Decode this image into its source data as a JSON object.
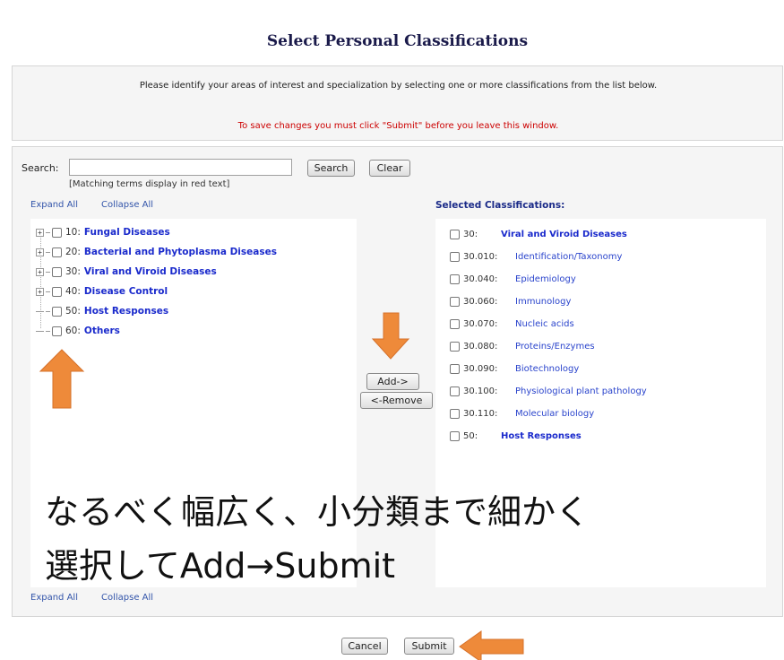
{
  "title": "Select Personal Classifications",
  "info": {
    "instruction": "Please identify your areas of interest and specialization by selecting one or more classifications from the list below.",
    "warning": "To save changes you must click \"Submit\" before you leave this window."
  },
  "search": {
    "label": "Search:",
    "value": "",
    "button_label": "Search",
    "clear_label": "Clear",
    "note": "[Matching terms display in red text]"
  },
  "links": {
    "expand_all": "Expand All",
    "collapse_all": "Collapse All"
  },
  "tree": {
    "items": [
      {
        "code": "10:",
        "label": "Fungal Diseases",
        "expandable": true
      },
      {
        "code": "20:",
        "label": "Bacterial and Phytoplasma Diseases",
        "expandable": true
      },
      {
        "code": "30:",
        "label": "Viral and Viroid Diseases",
        "expandable": true
      },
      {
        "code": "40:",
        "label": "Disease Control",
        "expandable": true
      },
      {
        "code": "50:",
        "label": "Host Responses",
        "expandable": false
      },
      {
        "code": "60:",
        "label": "Others",
        "expandable": false
      }
    ]
  },
  "actions": {
    "add_label": "Add->",
    "remove_label": "<-Remove"
  },
  "selected": {
    "heading": "Selected Classifications:",
    "items": [
      {
        "code": "30:",
        "label": "Viral and Viroid Diseases",
        "bold": true
      },
      {
        "code": "30.010:",
        "label": "Identification/Taxonomy",
        "bold": false
      },
      {
        "code": "30.040:",
        "label": "Epidemiology",
        "bold": false
      },
      {
        "code": "30.060:",
        "label": "Immunology",
        "bold": false
      },
      {
        "code": "30.070:",
        "label": "Nucleic acids",
        "bold": false
      },
      {
        "code": "30.080:",
        "label": "Proteins/Enzymes",
        "bold": false
      },
      {
        "code": "30.090:",
        "label": "Biotechnology",
        "bold": false
      },
      {
        "code": "30.100:",
        "label": "Physiological plant pathology",
        "bold": false
      },
      {
        "code": "30.110:",
        "label": "Molecular biology",
        "bold": false
      },
      {
        "code": "50:",
        "label": "Host Responses",
        "bold": true
      }
    ]
  },
  "overlay": {
    "line1": "なるべく幅広く、小分類まで細かく",
    "line2": "選択してAdd→Submit"
  },
  "footer": {
    "cancel_label": "Cancel",
    "submit_label": "Submit"
  },
  "colors": {
    "arrow": "#ee8a3a",
    "link": "#3355aa",
    "warning": "#cc0000",
    "tree_label": "#1a2acc"
  }
}
